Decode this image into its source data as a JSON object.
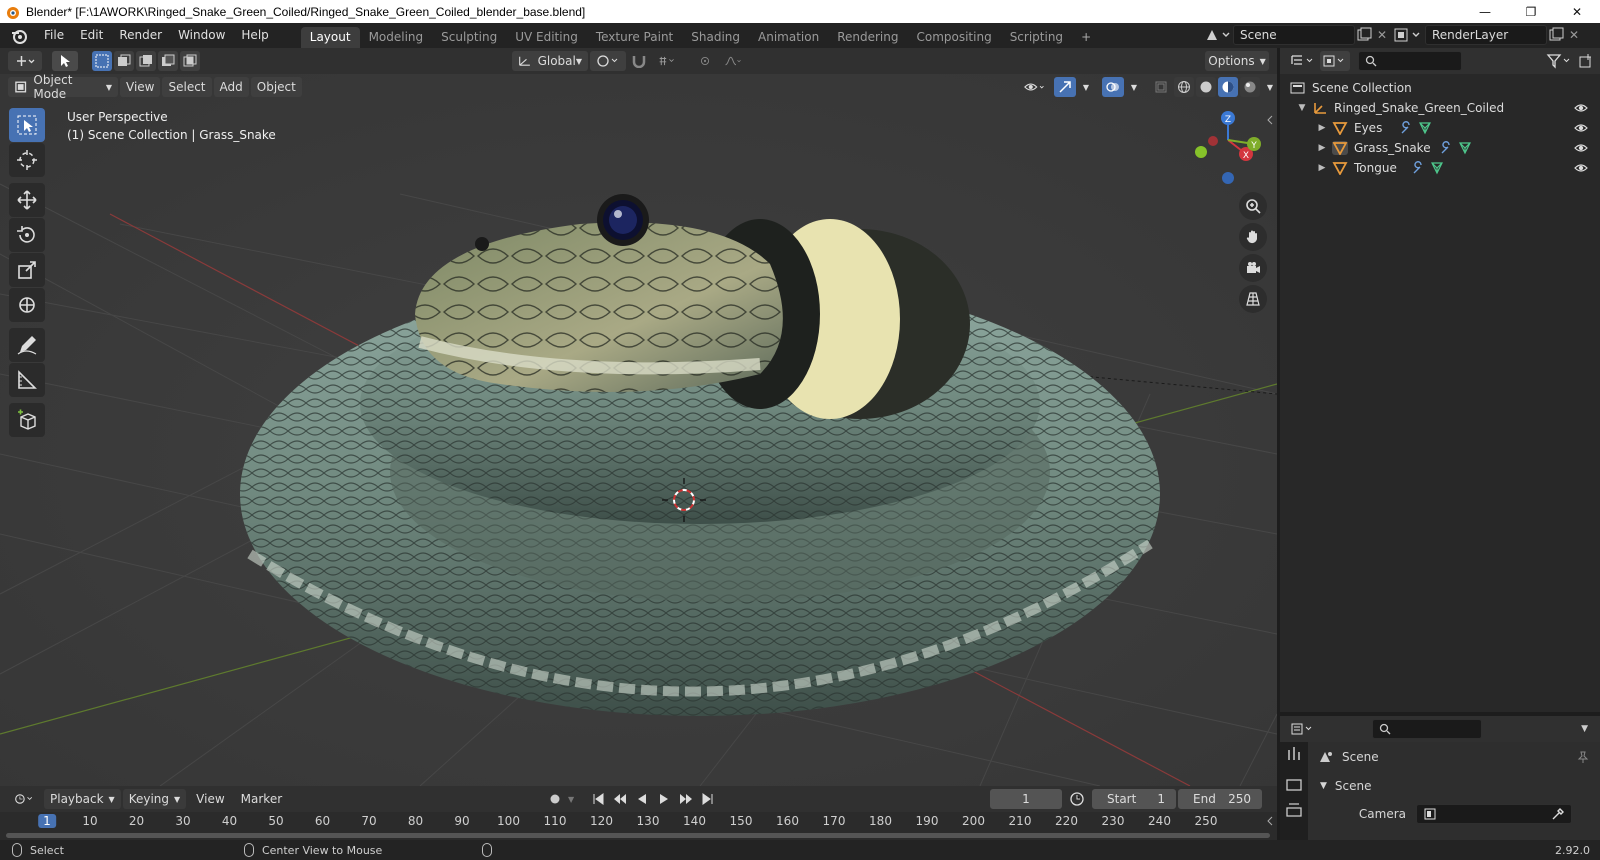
{
  "window": {
    "title": "Blender* [F:\\1AWORK\\Ringed_Snake_Green_Coiled/Ringed_Snake_Green_Coiled_blender_base.blend]",
    "controls": [
      "—",
      "❐",
      "✕"
    ]
  },
  "menu": [
    "File",
    "Edit",
    "Render",
    "Window",
    "Help"
  ],
  "workspaces": {
    "tabs": [
      "Layout",
      "Modeling",
      "Sculpting",
      "UV Editing",
      "Texture Paint",
      "Shading",
      "Animation",
      "Rendering",
      "Compositing",
      "Scripting"
    ],
    "active": "Layout",
    "add": "+"
  },
  "scene_selector": {
    "scene": "Scene",
    "view_layer": "RenderLayer"
  },
  "viewport_header": {
    "transform_orientation": "Global",
    "options": "Options",
    "mode": "Object Mode",
    "menus": [
      "View",
      "Select",
      "Add",
      "Object"
    ]
  },
  "viewport": {
    "perspective": "User Perspective",
    "collection_info": "(1) Scene Collection | Grass_Snake",
    "axis_labels": {
      "x": "X",
      "y": "Y",
      "z": "Z"
    }
  },
  "toolbar": {
    "tools": [
      "select-box",
      "cursor",
      "move",
      "rotate",
      "scale",
      "transform",
      "annotate",
      "measure",
      "add-cube"
    ],
    "active": "select-box"
  },
  "outliner": {
    "root": "Scene Collection",
    "collection": "Ringed_Snake_Green_Coiled",
    "objects": [
      "Eyes",
      "Grass_Snake",
      "Tongue"
    ]
  },
  "properties": {
    "scene_label": "Scene",
    "section": "Scene",
    "camera_label": "Camera"
  },
  "timeline": {
    "menus": [
      "Playback",
      "Keying",
      "View",
      "Marker"
    ],
    "current_frame": "1",
    "start_label": "Start",
    "start": "1",
    "end_label": "End",
    "end": "250",
    "ruler": [
      "1",
      "10",
      "20",
      "30",
      "40",
      "50",
      "60",
      "70",
      "80",
      "90",
      "100",
      "110",
      "120",
      "130",
      "140",
      "150",
      "160",
      "170",
      "180",
      "190",
      "200",
      "210",
      "220",
      "230",
      "240",
      "250"
    ]
  },
  "statusbar": {
    "left": "Select",
    "middle": "Center View to Mouse",
    "version": "2.92.0"
  }
}
